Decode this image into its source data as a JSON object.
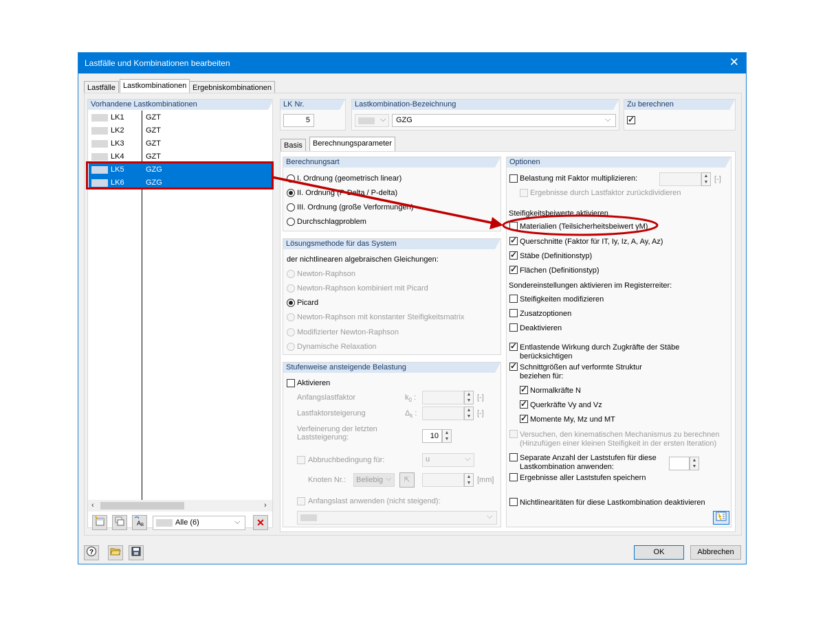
{
  "window": {
    "title": "Lastfälle und Kombinationen bearbeiten",
    "close": "✕"
  },
  "tabs": [
    "Lastfälle",
    "Lastkombinationen",
    "Ergebniskombinationen"
  ],
  "list": {
    "header": "Vorhandene Lastkombinationen",
    "rows": [
      {
        "id": "LK1",
        "name": "GZT"
      },
      {
        "id": "LK2",
        "name": "GZT"
      },
      {
        "id": "LK3",
        "name": "GZT"
      },
      {
        "id": "LK4",
        "name": "GZT"
      },
      {
        "id": "LK5",
        "name": "GZG"
      },
      {
        "id": "LK6",
        "name": "GZG"
      }
    ],
    "filter": "Alle (6)"
  },
  "lk": {
    "nr_label": "LK Nr.",
    "nr_value": "5",
    "bez_label": "Lastkombination-Bezeichnung",
    "bez_value": "GZG",
    "zu_label": "Zu berechnen"
  },
  "subtabs": [
    "Basis",
    "Berechnungsparameter"
  ],
  "berechnungsart": {
    "title": "Berechnungsart",
    "options": [
      "I. Ordnung (geometrisch linear)",
      "II. Ordnung (P-Delta / P-delta)",
      "III. Ordnung (große Verformungen)",
      "Durchschlagproblem"
    ]
  },
  "loesung": {
    "title": "Lösungsmethode für das System",
    "subtitle": "der nichtlinearen algebraischen Gleichungen:",
    "options": [
      "Newton-Raphson",
      "Newton-Raphson kombiniert mit Picard",
      "Picard",
      "Newton-Raphson mit konstanter Steifigkeitsmatrix",
      "Modifizierter Newton-Raphson",
      "Dynamische Relaxation"
    ]
  },
  "stufen": {
    "title": "Stufenweise ansteigende Belastung",
    "aktivieren": "Aktivieren",
    "anfang": "Anfangslastfaktor",
    "anfang_sym": "k",
    "anfang_sub": "0",
    "steig": "Lastfaktorsteigerung",
    "steig_sym": "Δ",
    "steig_sub": "k",
    "unit": "[-]",
    "verf1": "Verfeinerung der letzten",
    "verf2": "Laststeigerung:",
    "verf_value": "10",
    "abbruch": "Abbruchbedingung für:",
    "abbruch_value": "u",
    "knoten": "Knoten Nr.:",
    "knoten_value": "Beliebig",
    "mm": "[mm]",
    "anfangslast": "Anfangslast anwenden (nicht steigend):"
  },
  "optionen": {
    "title": "Optionen",
    "faktor": "Belastung mit Faktor multiplizieren:",
    "faktor_unit": "[-]",
    "dividieren": "Ergebnisse durch Lastfaktor zurückdividieren",
    "steif_title": "Steifigkeitsbeiwerte aktivieren",
    "materialien": "Materialien (Teilsicherheitsbeiwert γM)",
    "querschnitte": "Querschnitte (Faktor für IT, Iy, Iz, A, Ay, Az)",
    "staebe": "Stäbe (Definitionstyp)",
    "flaechen": "Flächen (Definitionstyp)",
    "sonder_title": "Sondereinstellungen aktivieren im Registerreiter:",
    "steif_mod": "Steifigkeiten modifizieren",
    "zusatz": "Zusatzoptionen",
    "deakt": "Deaktivieren",
    "entlast1": "Entlastende Wirkung durch Zugkräfte der Stäbe",
    "entlast2": "berücksichtigen",
    "schnitt1": "Schnittgrößen auf verformte Struktur",
    "schnitt2": "beziehen für:",
    "normal": "Normalkräfte N",
    "quer": "Querkräfte Vy and Vz",
    "momente": "Momente My, Mz und MT",
    "versuchen1": "Versuchen, den kinematischen Mechanismus zu berechnen",
    "versuchen2": "(Hinzufügen einer kleinen Steifigkeit in der ersten Iteration)",
    "separate1": "Separate Anzahl der Laststufen für diese",
    "separate2": "Lastkombination anwenden:",
    "alle": "Ergebnisse aller Laststufen speichern",
    "nichtlin": "Nichtlinearitäten für diese Lastkombination deaktivieren"
  },
  "footer": {
    "ok": "OK",
    "cancel": "Abbrechen"
  },
  "annotation_color": "#c00000",
  "accent": "#0078d7"
}
